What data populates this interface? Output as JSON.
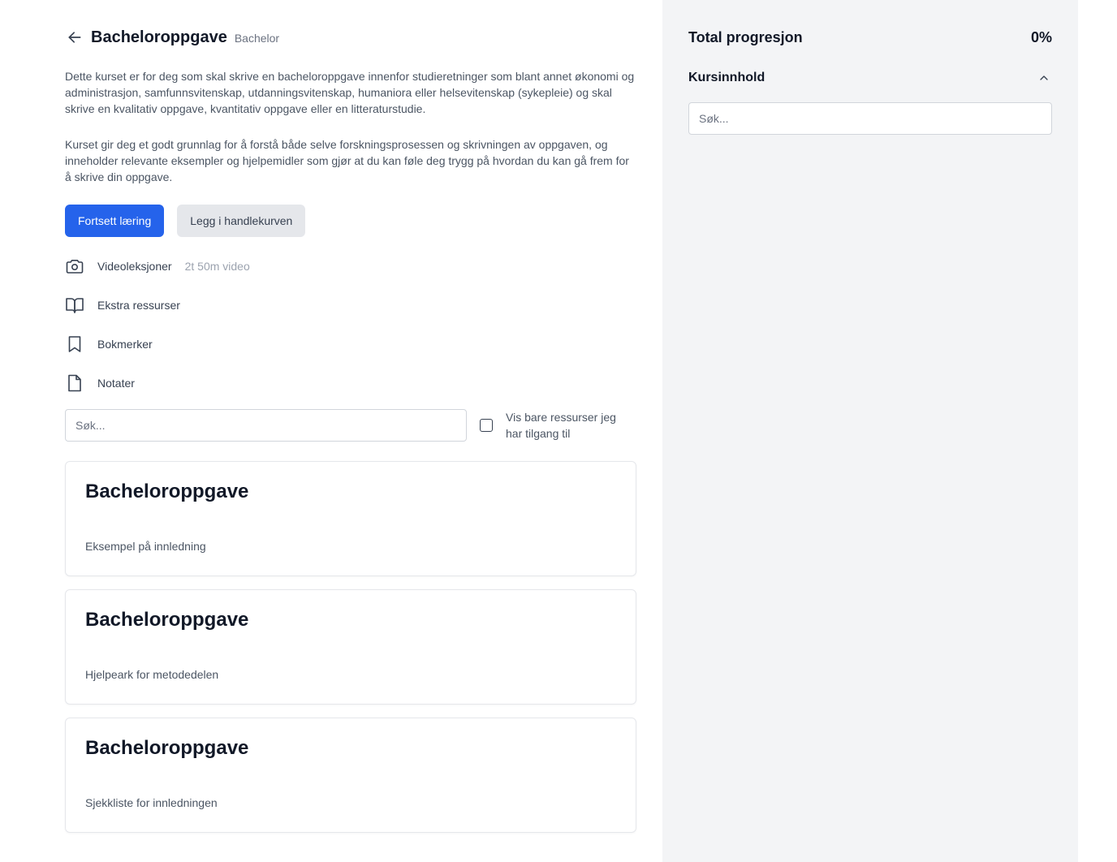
{
  "header": {
    "title": "Bacheloroppgave",
    "tag": "Bachelor"
  },
  "description": {
    "paragraph1": "Dette kurset er for deg som skal skrive en bacheloroppgave innenfor studieretninger som blant annet økonomi og administrasjon, samfunnsvitenskap, utdanningsvitenskap, humaniora eller helsevitenskap (sykepleie) og skal skrive en kvalitativ oppgave, kvantitativ oppgave eller en litteraturstudie.",
    "paragraph2": "Kurset gir deg et godt grunnlag for å forstå både selve forskningsprosessen og skrivningen av oppgaven, og inneholder relevante eksempler og hjelpemidler som gjør at du kan føle deg trygg på hvordan du kan gå frem for å skrive din oppgave."
  },
  "actions": {
    "continue_label": "Fortsett læring",
    "cart_label": "Legg i handlekurven"
  },
  "features": {
    "video": {
      "label": "Videoleksjoner",
      "sub": "2t 50m video",
      "icon": "camera-icon"
    },
    "resources": {
      "label": "Ekstra ressurser",
      "icon": "book-open-icon"
    },
    "bookmarks": {
      "label": "Bokmerker",
      "icon": "bookmark-icon"
    },
    "notes": {
      "label": "Notater",
      "icon": "document-icon"
    }
  },
  "filter": {
    "search_placeholder": "Søk...",
    "checkbox_label": "Vis bare ressurser jeg har tilgang til",
    "checkbox_checked": false
  },
  "cards": [
    {
      "title": "Bacheloroppgave",
      "subtitle": "Eksempel på innledning"
    },
    {
      "title": "Bacheloroppgave",
      "subtitle": "Hjelpeark for metodedelen"
    },
    {
      "title": "Bacheloroppgave",
      "subtitle": "Sjekkliste for innledningen"
    }
  ],
  "sidebar": {
    "progress_label": "Total progresjon",
    "progress_value": "0%",
    "progress_fraction": 0,
    "content_label": "Kursinnhold",
    "search_placeholder": "Søk..."
  },
  "colors": {
    "primary": "#2563eb",
    "sidebar_bg": "#f3f4f6",
    "secondary_btn": "#e5e7eb"
  }
}
